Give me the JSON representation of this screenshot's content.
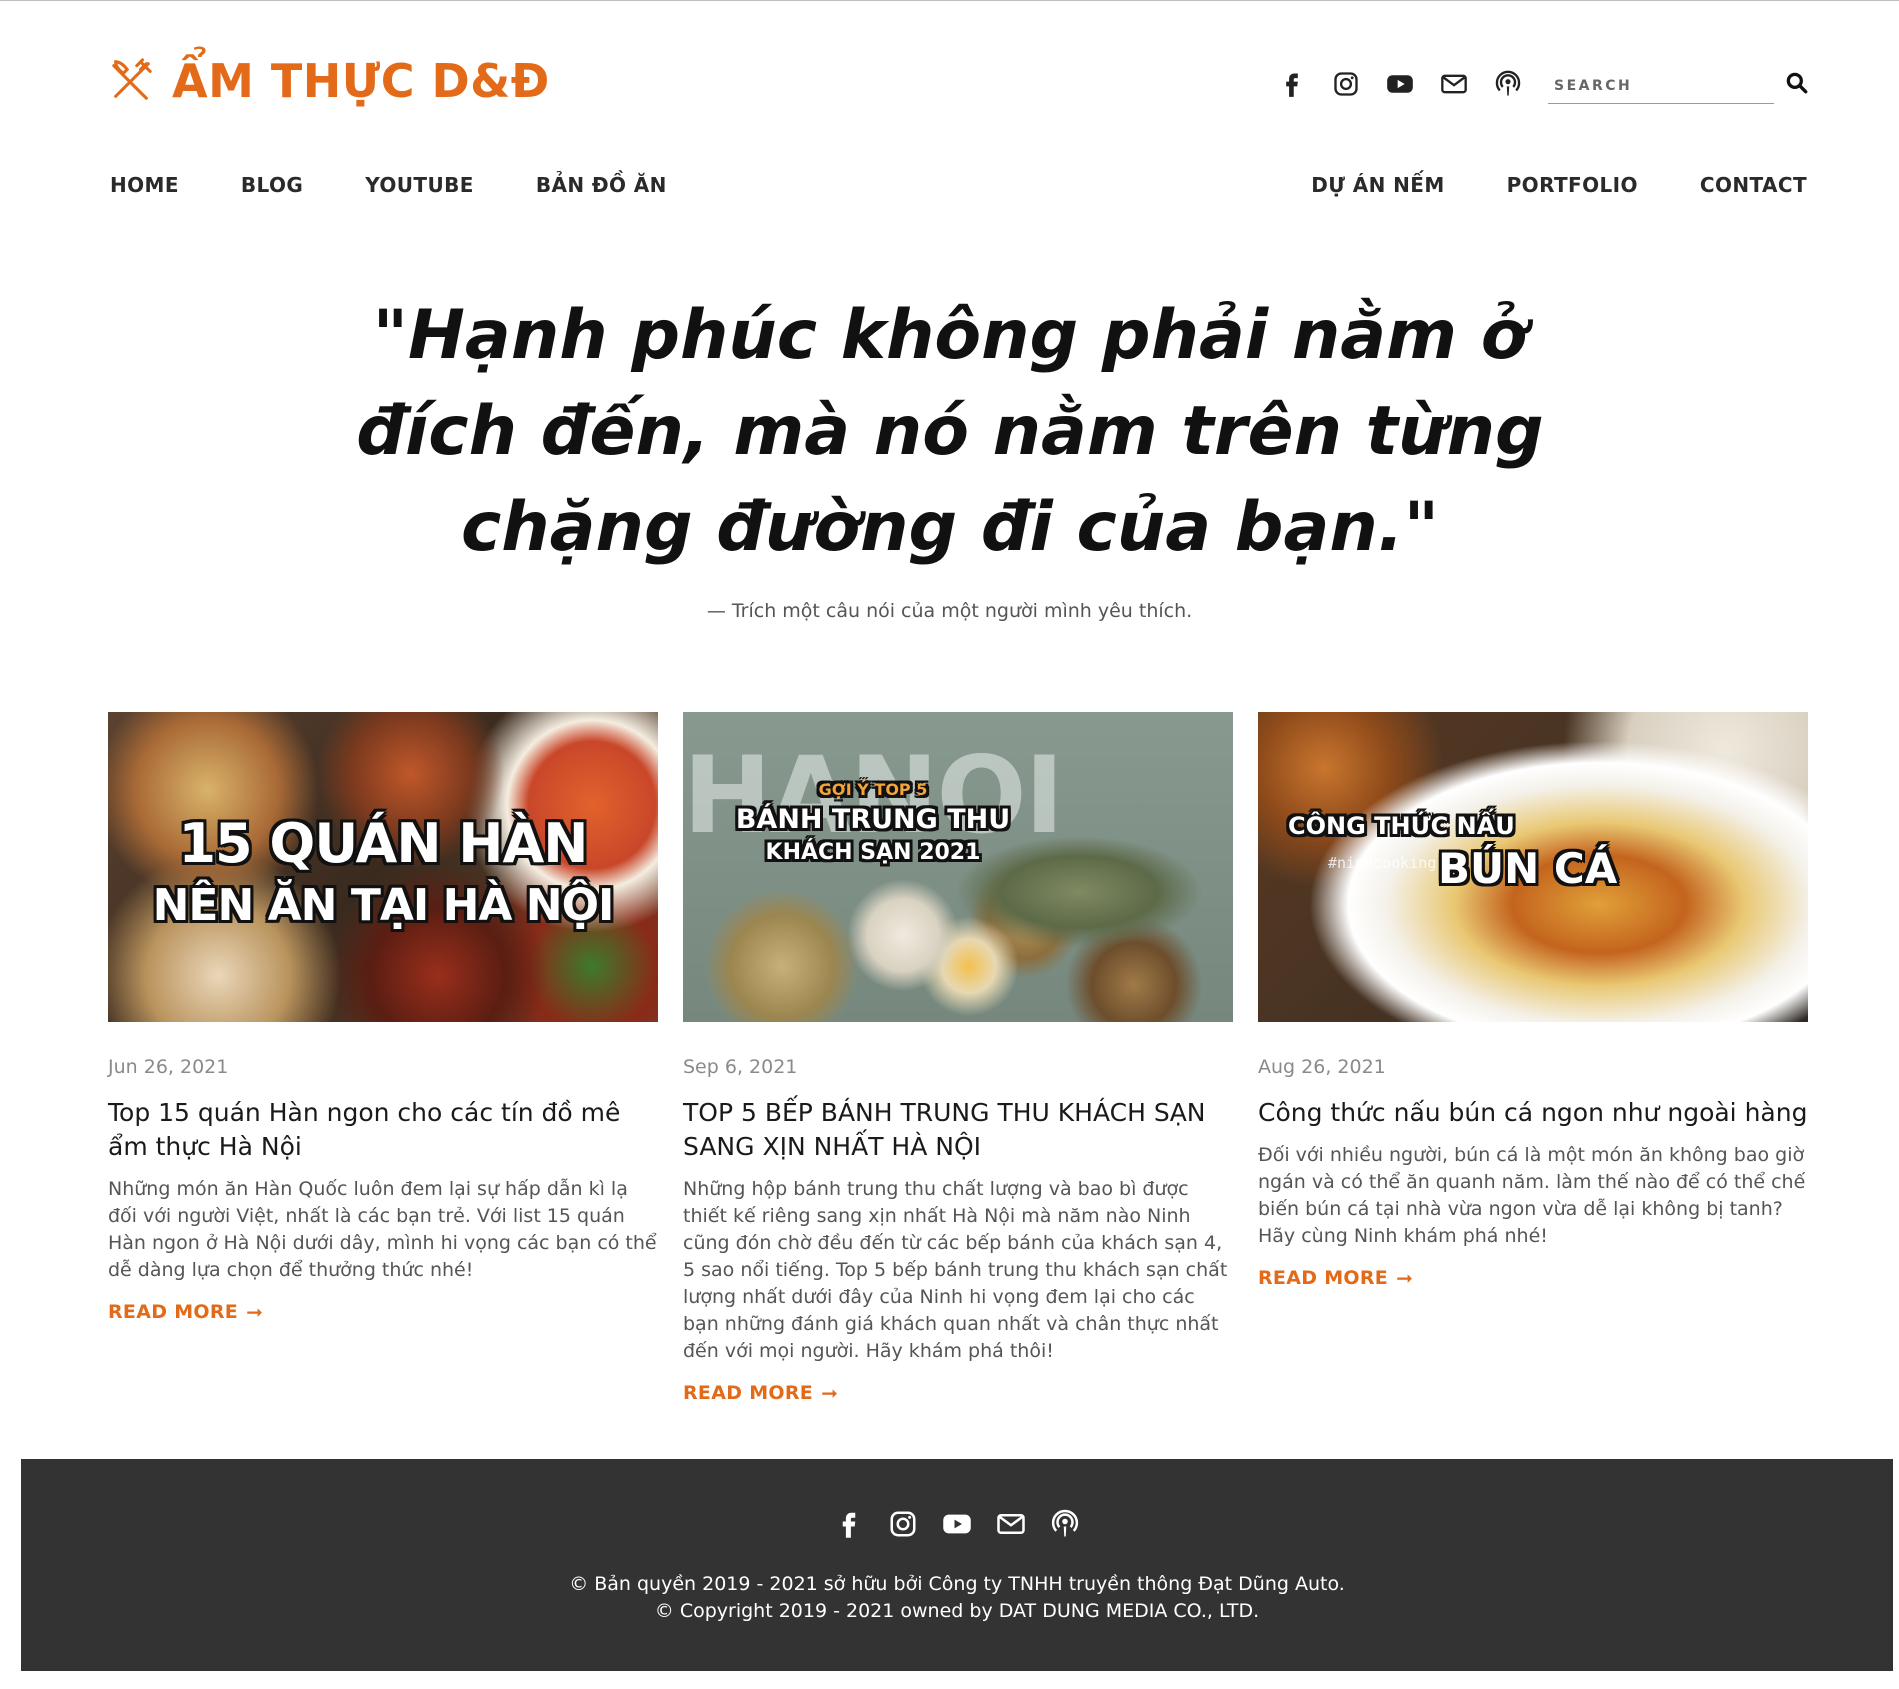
{
  "site": {
    "logo_text": "ẨM THỰC D&Đ",
    "brand_color": "#e26a19"
  },
  "header": {
    "social": [
      "facebook-icon",
      "instagram-icon",
      "youtube-icon",
      "mail-icon",
      "podcast-icon"
    ],
    "search_placeholder": "SEARCH"
  },
  "nav": {
    "left": [
      "HOME",
      "BLOG",
      "YOUTUBE",
      "BẢN ĐỒ ĂN"
    ],
    "right": [
      "DỰ ÁN NẾM",
      "PORTFOLIO",
      "CONTACT"
    ]
  },
  "hero": {
    "quote": "\"Hạnh phúc không phải nằm ở đích đến, mà nó nằm trên từng chặng đường đi của bạn.\"",
    "source": "— Trích một câu nói của một người mình yêu thích."
  },
  "posts": [
    {
      "thumb_text_1": "15 QUÁN HÀN",
      "thumb_text_2": "NÊN ĂN TẠI HÀ NỘI",
      "date": "Jun 26, 2021",
      "title": "Top 15 quán Hàn ngon cho các tín đồ mê ẩm thực Hà Nội",
      "excerpt": "Những món ăn Hàn Quốc luôn đem lại sự hấp dẫn kì lạ đối với người Việt, nhất là các bạn trẻ. Với list 15 quán Hàn ngon ở Hà Nội dưới dây, mình hi vọng các bạn có thể dễ dàng lựa chọn để thưởng thức nhé!",
      "more": "READ MORE"
    },
    {
      "thumb_bg_text": "HANOI",
      "thumb_text_1": "GỢI Ý TOP 5",
      "thumb_text_2": "BÁNH TRUNG THU",
      "thumb_text_3": "KHÁCH SẠN 2021",
      "date": "Sep 6, 2021",
      "title": "TOP 5 BẾP BÁNH TRUNG THU KHÁCH SẠN SANG XỊN NHẤT HÀ NỘI",
      "excerpt": "Những hộp bánh trung thu chất lượng và bao bì được thiết kế riêng sang xịn nhất Hà Nội mà năm nào Ninh cũng đón chờ đều đến từ các bếp bánh của khách sạn 4, 5 sao nổi tiếng. Top 5 bếp bánh trung thu khách sạn chất lượng nhất dưới đây của Ninh hi vọng đem lại cho các bạn những đánh giá khách quan nhất và chân thực nhất đến với mọi người. Hãy khám phá thôi!",
      "more": "READ MORE"
    },
    {
      "thumb_text_1": "CÔNG THỨC NẤU",
      "thumb_tag": "#ninhcooking",
      "thumb_text_2": "BÚN CÁ",
      "date": "Aug 26, 2021",
      "title": "Công thức nấu bún cá ngon như ngoài hàng",
      "excerpt": "Đối với nhiều người, bún cá là một món ăn không bao giờ ngán và có thể ăn quanh năm. làm thế nào để có thể chế biến bún cá tại nhà vừa ngon vừa dễ lại không bị tanh? Hãy cùng Ninh khám phá nhé!",
      "more": "READ MORE"
    }
  ],
  "footer": {
    "line1": "© Bản quyền 2019 - 2021 sở hữu bởi Công ty TNHH truyền thông Đạt Dũng Auto.",
    "line2": "© Copyright 2019 - 2021 owned by DAT DUNG MEDIA CO., LTD.",
    "bg_color": "#333333"
  }
}
